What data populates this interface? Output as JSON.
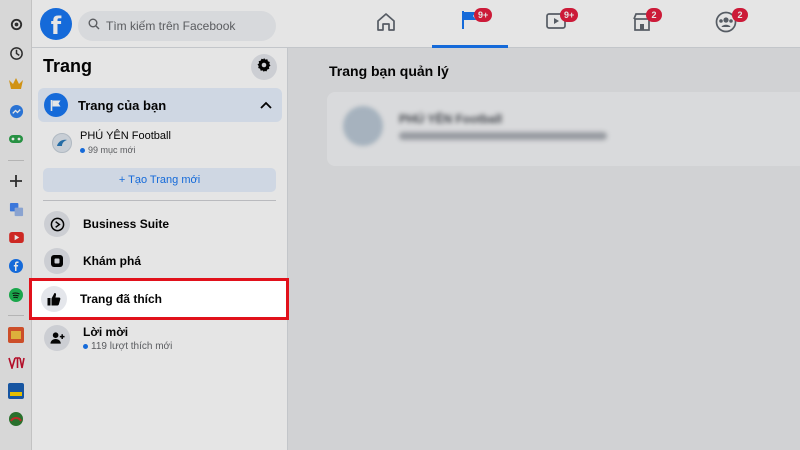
{
  "browser_rail": {
    "icons": [
      "settings-icon",
      "history-icon",
      "crown-icon",
      "messenger-icon",
      "game-icon",
      "add-icon",
      "translate-icon",
      "youtube-icon",
      "facebook-icon",
      "spotify-icon",
      "app-icon",
      "vtv-icon",
      "app-icon-2",
      "app-icon-3"
    ]
  },
  "topbar": {
    "logo": "f",
    "search_placeholder": "Tìm kiếm trên Facebook",
    "tabs": [
      {
        "name": "home",
        "badge": ""
      },
      {
        "name": "pages",
        "badge": "9+"
      },
      {
        "name": "watch",
        "badge": "9+"
      },
      {
        "name": "marketplace",
        "badge": "2"
      },
      {
        "name": "groups",
        "badge": "2"
      }
    ]
  },
  "sidebar": {
    "title": "Trang",
    "your_pages_label": "Trang của bạn",
    "page": {
      "name": "PHÚ YÊN Football",
      "sub": "99 mục mới"
    },
    "create_label": "+ Tạo Trang mới",
    "items": [
      {
        "label": "Business Suite",
        "sub": ""
      },
      {
        "label": "Khám phá",
        "sub": ""
      },
      {
        "label": "Trang đã thích",
        "sub": ""
      },
      {
        "label": "Lời mời",
        "sub": "119 lượt thích mới"
      }
    ]
  },
  "main": {
    "title": "Trang bạn quản lý",
    "card_name": "PHÚ YÊN Football"
  },
  "colors": {
    "accent": "#1877f2",
    "highlight": "#e1111b",
    "badge": "#e41e3f"
  }
}
